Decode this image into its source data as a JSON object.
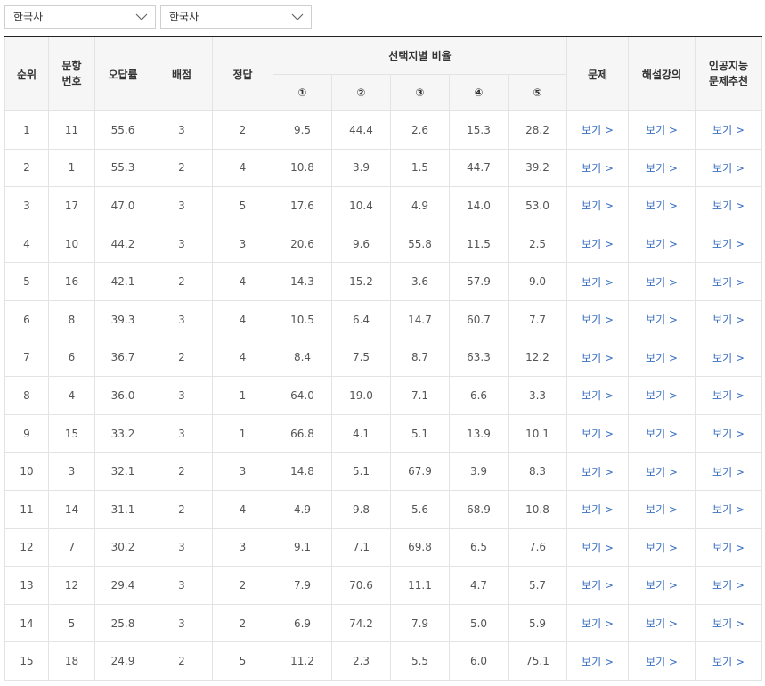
{
  "filters": [
    {
      "value": "한국사"
    },
    {
      "value": "한국사"
    }
  ],
  "table": {
    "headers": {
      "rank": "순위",
      "question_no": "문항\n번호",
      "error_rate": "오답률",
      "points": "배점",
      "answer": "정답",
      "choice_ratio": "선택지별 비율",
      "choices": [
        "①",
        "②",
        "③",
        "④",
        "⑤"
      ],
      "problem": "문제",
      "lecture": "해설강의",
      "ai_reco": "인공지능\n문제추천"
    },
    "link_label": "보기 >",
    "rows": [
      {
        "rank": "1",
        "q": "11",
        "err": "55.6",
        "pts": "3",
        "ans": "2",
        "c": [
          "9.5",
          "44.4",
          "2.6",
          "15.3",
          "28.2"
        ]
      },
      {
        "rank": "2",
        "q": "1",
        "err": "55.3",
        "pts": "2",
        "ans": "4",
        "c": [
          "10.8",
          "3.9",
          "1.5",
          "44.7",
          "39.2"
        ]
      },
      {
        "rank": "3",
        "q": "17",
        "err": "47.0",
        "pts": "3",
        "ans": "5",
        "c": [
          "17.6",
          "10.4",
          "4.9",
          "14.0",
          "53.0"
        ]
      },
      {
        "rank": "4",
        "q": "10",
        "err": "44.2",
        "pts": "3",
        "ans": "3",
        "c": [
          "20.6",
          "9.6",
          "55.8",
          "11.5",
          "2.5"
        ]
      },
      {
        "rank": "5",
        "q": "16",
        "err": "42.1",
        "pts": "2",
        "ans": "4",
        "c": [
          "14.3",
          "15.2",
          "3.6",
          "57.9",
          "9.0"
        ]
      },
      {
        "rank": "6",
        "q": "8",
        "err": "39.3",
        "pts": "3",
        "ans": "4",
        "c": [
          "10.5",
          "6.4",
          "14.7",
          "60.7",
          "7.7"
        ]
      },
      {
        "rank": "7",
        "q": "6",
        "err": "36.7",
        "pts": "2",
        "ans": "4",
        "c": [
          "8.4",
          "7.5",
          "8.7",
          "63.3",
          "12.2"
        ]
      },
      {
        "rank": "8",
        "q": "4",
        "err": "36.0",
        "pts": "3",
        "ans": "1",
        "c": [
          "64.0",
          "19.0",
          "7.1",
          "6.6",
          "3.3"
        ]
      },
      {
        "rank": "9",
        "q": "15",
        "err": "33.2",
        "pts": "3",
        "ans": "1",
        "c": [
          "66.8",
          "4.1",
          "5.1",
          "13.9",
          "10.1"
        ]
      },
      {
        "rank": "10",
        "q": "3",
        "err": "32.1",
        "pts": "2",
        "ans": "3",
        "c": [
          "14.8",
          "5.1",
          "67.9",
          "3.9",
          "8.3"
        ]
      },
      {
        "rank": "11",
        "q": "14",
        "err": "31.1",
        "pts": "2",
        "ans": "4",
        "c": [
          "4.9",
          "9.8",
          "5.6",
          "68.9",
          "10.8"
        ]
      },
      {
        "rank": "12",
        "q": "7",
        "err": "30.2",
        "pts": "3",
        "ans": "3",
        "c": [
          "9.1",
          "7.1",
          "69.8",
          "6.5",
          "7.6"
        ]
      },
      {
        "rank": "13",
        "q": "12",
        "err": "29.4",
        "pts": "3",
        "ans": "2",
        "c": [
          "7.9",
          "70.6",
          "11.1",
          "4.7",
          "5.7"
        ]
      },
      {
        "rank": "14",
        "q": "5",
        "err": "25.8",
        "pts": "3",
        "ans": "2",
        "c": [
          "6.9",
          "74.2",
          "7.9",
          "5.0",
          "5.9"
        ]
      },
      {
        "rank": "15",
        "q": "18",
        "err": "24.9",
        "pts": "2",
        "ans": "5",
        "c": [
          "11.2",
          "2.3",
          "5.5",
          "6.0",
          "75.1"
        ]
      }
    ]
  }
}
